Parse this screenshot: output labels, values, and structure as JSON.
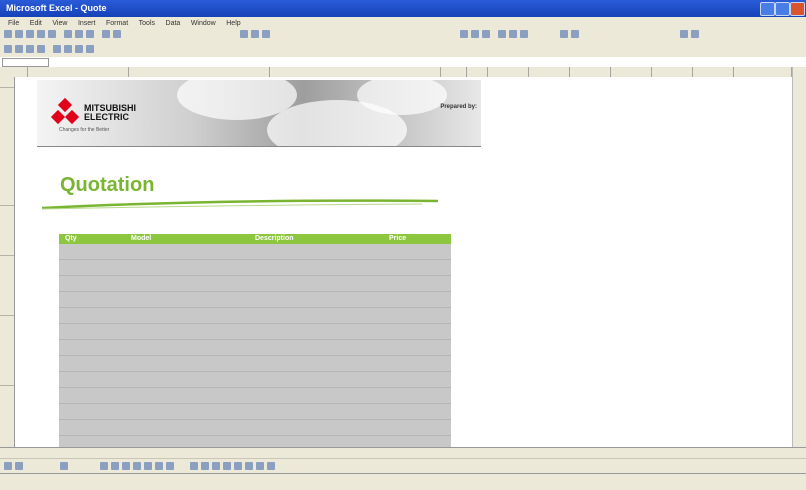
{
  "window": {
    "title": "Microsoft Excel - Quote"
  },
  "menu": {
    "items": [
      "File",
      "Edit",
      "View",
      "Insert",
      "Format",
      "Tools",
      "Data",
      "Window",
      "Help"
    ]
  },
  "document": {
    "brand_line1": "MITSUBISHI",
    "brand_line2": "ELECTRIC",
    "tagline": "Changes for the Better",
    "prepared_label": "Prepared by:",
    "quote_title": "Quotation",
    "table": {
      "headers": [
        "Qty",
        "Model",
        "Description",
        "Price"
      ],
      "rows": 13
    }
  },
  "colors": {
    "accent_green": "#7ab532",
    "header_green": "#8dc63f",
    "row_gray": "#c8c8c8",
    "logo_red": "#e0001a"
  }
}
